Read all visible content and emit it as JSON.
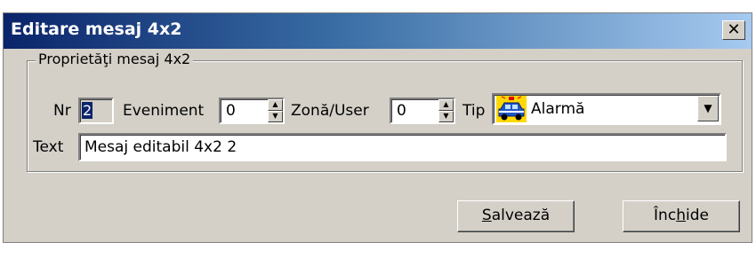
{
  "window": {
    "title": "Editare mesaj 4x2",
    "close_glyph": "✕"
  },
  "group": {
    "legend": "Proprietăţi mesaj 4x2"
  },
  "fields": {
    "nr_label": "Nr",
    "nr_value": "2",
    "eveniment_label": "Eveniment",
    "eveniment_value": "0",
    "zona_label": "Zonă/User",
    "zona_value": "0",
    "tip_label": "Tip",
    "tip_value": "Alarmă",
    "tip_icon": "police-car-icon",
    "text_label": "Text",
    "text_value": "Mesaj editabil 4x2 2"
  },
  "buttons": {
    "save_mnemonic": "S",
    "save_rest": "alvează",
    "close_pre": "Înc",
    "close_mnemonic": "h",
    "close_rest": "ide"
  }
}
